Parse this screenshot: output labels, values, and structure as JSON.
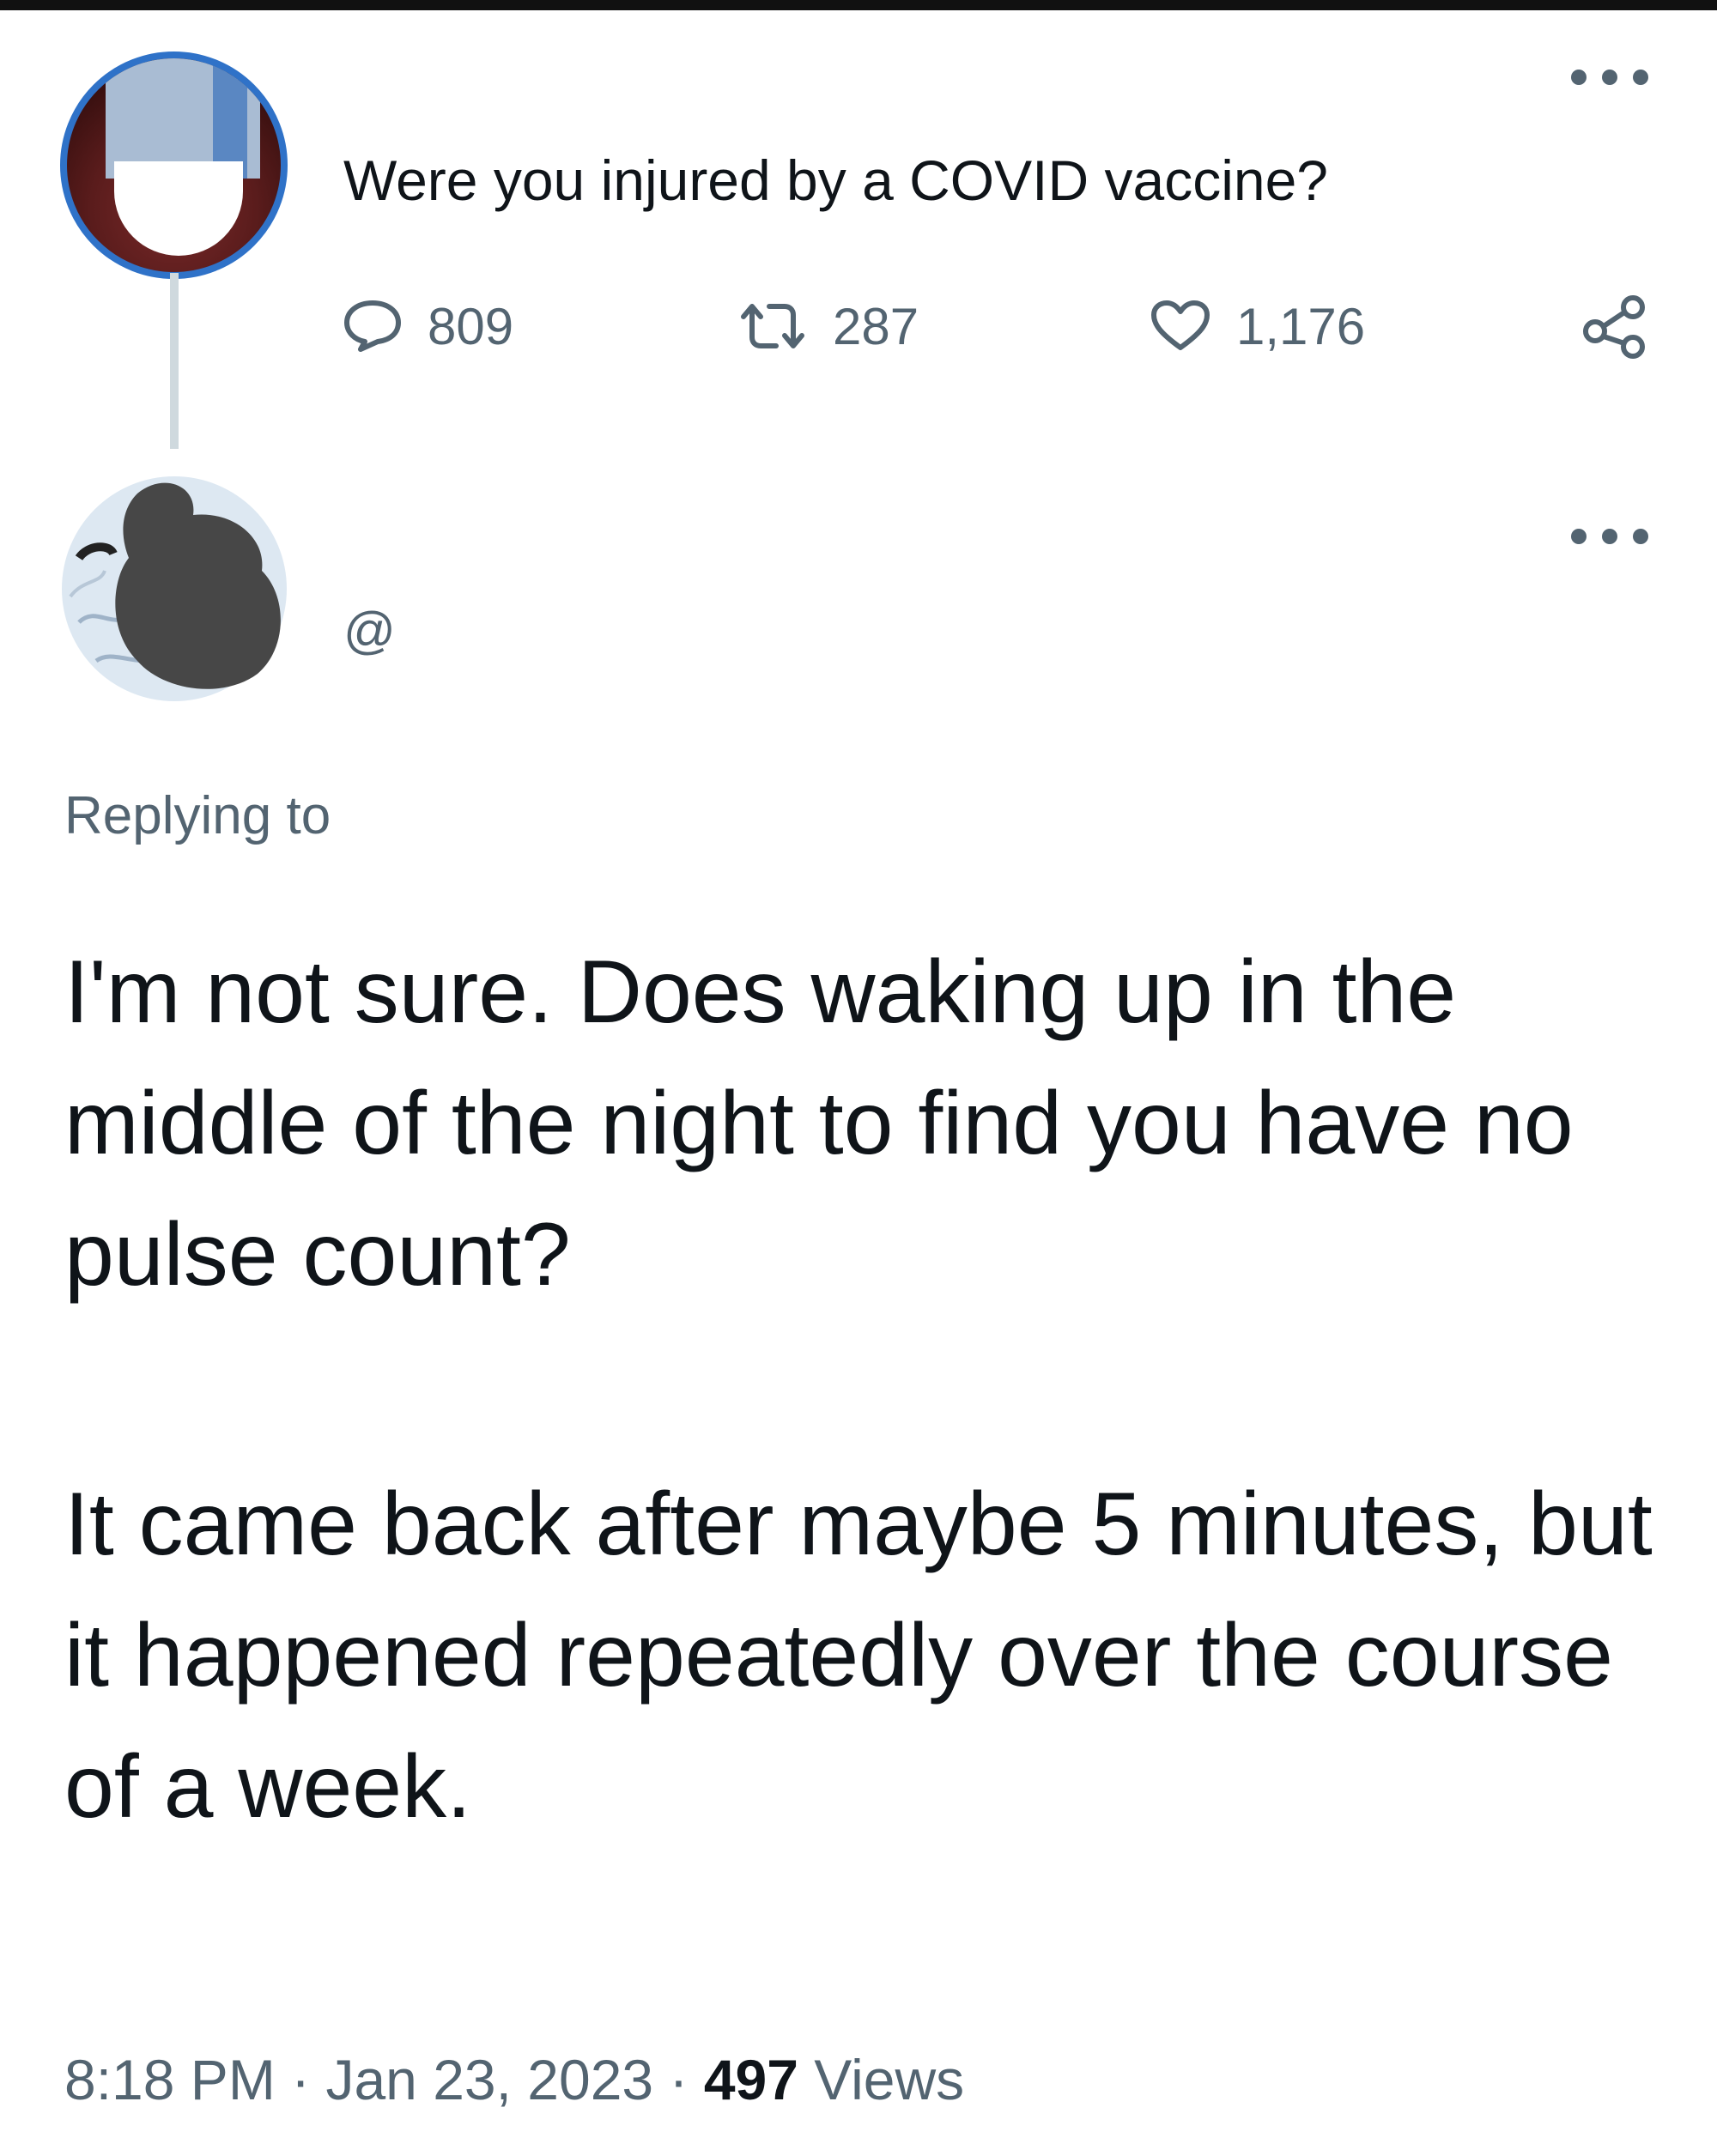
{
  "tweet_1": {
    "text": "Were you injured by a COVID vaccine?",
    "replies": "809",
    "retweets": "287",
    "likes": "1,176"
  },
  "tweet_2": {
    "handle": "@",
    "replying_to": "Replying to",
    "paragraphs": [
      "I'm not sure. Does waking up in the middle of the night to find you have no pulse count?",
      "It came back after maybe 5 minutes, but it happened repeatedly over the course of a week."
    ],
    "time": "8:18 PM",
    "date": "Jan 23, 2023",
    "views_count": "497",
    "views_label": "Views",
    "separator": "·"
  },
  "icons": {
    "reply": "speech-bubble-icon",
    "retweet": "retweet-icon",
    "like": "heart-icon",
    "share": "share-icon",
    "more": "more-dots-icon"
  },
  "colors": {
    "text_primary": "#0f1419",
    "text_secondary": "#536471",
    "avatar_ring": "#2f72c8",
    "thread_line": "#cfd9de"
  }
}
